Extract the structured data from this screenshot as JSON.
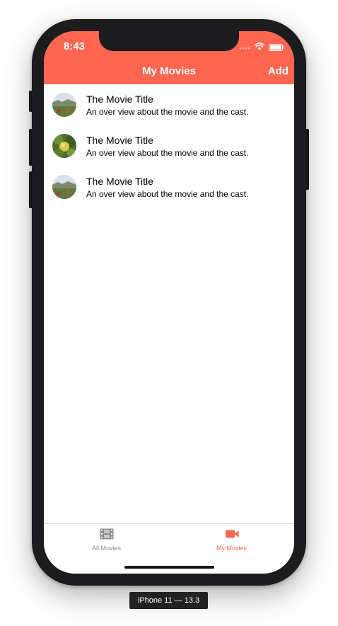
{
  "status_bar": {
    "time": "8:43"
  },
  "nav": {
    "title": "My Movies",
    "add_label": "Add"
  },
  "movies": [
    {
      "title": "The Movie Title",
      "overview": "An over view about the movie and the cast."
    },
    {
      "title": "The Movie Title",
      "overview": "An over view about the movie and the cast."
    },
    {
      "title": "The Movie Title",
      "overview": "An over view about the movie and the cast."
    }
  ],
  "tabs": [
    {
      "label": "All Movies",
      "icon": "film-icon",
      "selected": false
    },
    {
      "label": "My Movies",
      "icon": "video-camera-icon",
      "selected": true
    }
  ],
  "device_label": "iPhone 11 — 13.3",
  "colors": {
    "accent": "#ff654f",
    "tab_inactive": "#8e8e93"
  }
}
